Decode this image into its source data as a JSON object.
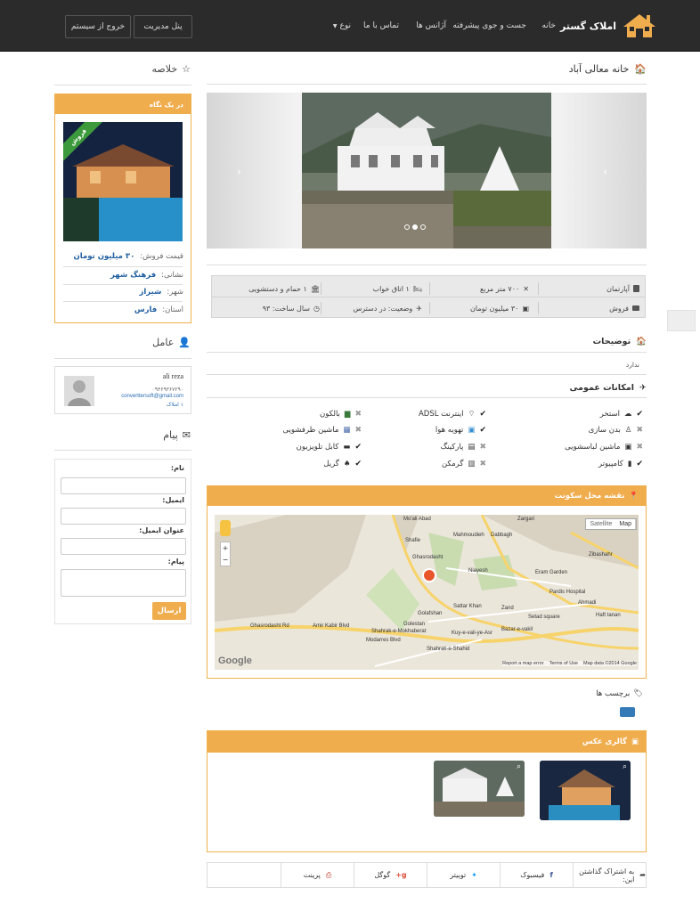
{
  "brand": {
    "name": "املاک گستر",
    "color": "#f0ad4e"
  },
  "nav": {
    "items": [
      "خانه",
      "جست و جوی پیشرفته",
      "آژانس ها",
      "تماس با ما",
      "نوع"
    ],
    "admin_btn": "پنل مدیریت",
    "logout_btn": "خروج از سیستم"
  },
  "property": {
    "title": "خانه معالی آباد",
    "info": {
      "type": "آپارتمان",
      "area": "۷۰۰ متر مربع",
      "bedrooms": "۱ اتاق خواب",
      "bathrooms": "۱ حمام و دستشویی",
      "deal": "فروش",
      "price": "۳۰ میلیون تومان",
      "status": "وضعیت: در دسترس",
      "year": "سال ساخت: ۹۳"
    },
    "description_title": "توضیحات",
    "description": "ندارد",
    "features_title": "امکانات عمومی",
    "features": [
      {
        "label": "استخر",
        "has": true
      },
      {
        "label": "اینترنت ADSL",
        "has": true
      },
      {
        "label": "بالکون",
        "has": false
      },
      {
        "label": "بدن سازی",
        "has": false
      },
      {
        "label": "تهویه هوا",
        "has": true
      },
      {
        "label": "ماشین ظرفشویی",
        "has": false
      },
      {
        "label": "ماشین لباسشویی",
        "has": false
      },
      {
        "label": "پارکینگ",
        "has": false
      },
      {
        "label": "کابل تلویزیون",
        "has": true
      },
      {
        "label": "کامپیوتر",
        "has": true
      },
      {
        "label": "گرمکن",
        "has": false
      },
      {
        "label": "گریل",
        "has": true
      }
    ]
  },
  "map": {
    "title": "نقشه محل سکونت",
    "btn_map": "Map",
    "btn_satellite": "Satellite",
    "google": "Google",
    "credits": [
      "Map data ©2014 Google",
      "Terms of Use",
      "Report a map error"
    ],
    "places": [
      "Mo'ali Abad",
      "Ghasrodasht",
      "Mahmoudieh",
      "Niayesh",
      "Eram Garden",
      "Zand",
      "Sattar Khan",
      "Setad square",
      "Bazar-e-vakil",
      "Haft tanan",
      "Golafshan",
      "Shahrak-e-Mokhaberat",
      "Shahrak-e-Shahid",
      "Kuy-e-vali-ye-Asr",
      "Ahmadi",
      "Zargari",
      "Pardis Hospital",
      "Zibashahr",
      "Shafie",
      "Dabbagh",
      "Modarres Blvd",
      "Ghasrodasht Rd",
      "Amir Kabir Blvd",
      "Golestan"
    ]
  },
  "tags_title": "برچسب ها",
  "gallery_title": "گالری عکس",
  "share": {
    "intro": "به اشتراک گذاشتن این:",
    "facebook": "فیسبوک",
    "twitter": "توییتر",
    "google": "گوگل",
    "print": "پرینت"
  },
  "sidebar": {
    "summary_title": "خلاصه",
    "card_title": "در یک نگاه",
    "ribbon": "فروش",
    "price_label": "قیمت فروش:",
    "price_value": "۳۰ میلیون تومان",
    "address_label": "نشانی:",
    "address_value": "فرهنگ شهر",
    "city_label": "شهر:",
    "city_value": "شیراز",
    "province_label": "استان:",
    "province_value": "فارس",
    "agent_title": "عامل",
    "agent_name": "ali reza",
    "agent_phone": "۰۹۳۶۹۳۶۷۲۹۰",
    "agent_email": "converttersoft@gmail.com",
    "agent_listings": "۱ املاک",
    "message_title": "پیام",
    "name_label": "نام:",
    "email_label": "ایمیل:",
    "email_title_label": "عنوان ایمیل:",
    "message_label": "پیام:",
    "send_btn": "ارسال"
  }
}
